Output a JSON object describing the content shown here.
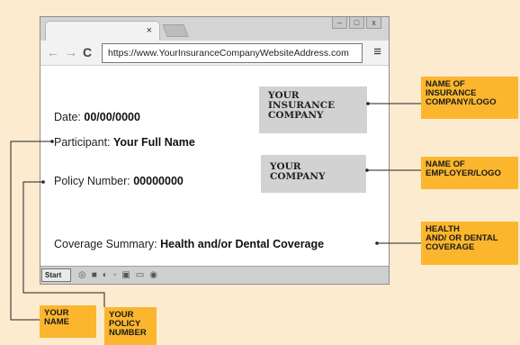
{
  "browser": {
    "tab_close": "×",
    "window_buttons": [
      "–",
      "□",
      "x"
    ],
    "nav": {
      "back": "←",
      "forward": "→",
      "reload": "C"
    },
    "url": "https://www.YourInsuranceCompanyWebsiteAddress.com",
    "menu_glyph": "≡"
  },
  "page": {
    "date_label": "Date:",
    "date_value": "00/00/0000",
    "participant_label": "Participant:",
    "participant_value": "Your Full Name",
    "policy_label": "Policy Number:",
    "policy_value": "00000000",
    "coverage_label": "Coverage Summary:",
    "coverage_value": "Health and/or Dental Coverage"
  },
  "boxes": {
    "insurance_company": [
      "YOUR",
      "INSURANCE",
      "COMPANY"
    ],
    "company": [
      "YOUR",
      "COMPANY"
    ]
  },
  "taskbar": {
    "start_label": "Start",
    "icons": [
      "◎",
      "■",
      "◐",
      "◦",
      "▣",
      "▭",
      "◉"
    ]
  },
  "callouts": {
    "insurance_logo": [
      "NAME OF",
      "INSURANCE",
      "COMPANY/LOGO"
    ],
    "employer_logo": [
      "NAME OF",
      "EMPLOYER/LOGO"
    ],
    "coverage": [
      "HEALTH",
      "AND/ OR DENTAL",
      "COVERAGE"
    ],
    "your_name": [
      "YOUR",
      "NAME"
    ],
    "policy_number": [
      "YOUR",
      "POLICY",
      "NUMBER"
    ]
  },
  "colors": {
    "background": "#fcebcf",
    "callout": "#fbb62e",
    "gray_box": "#d2d2d2",
    "connector": "#222222"
  }
}
